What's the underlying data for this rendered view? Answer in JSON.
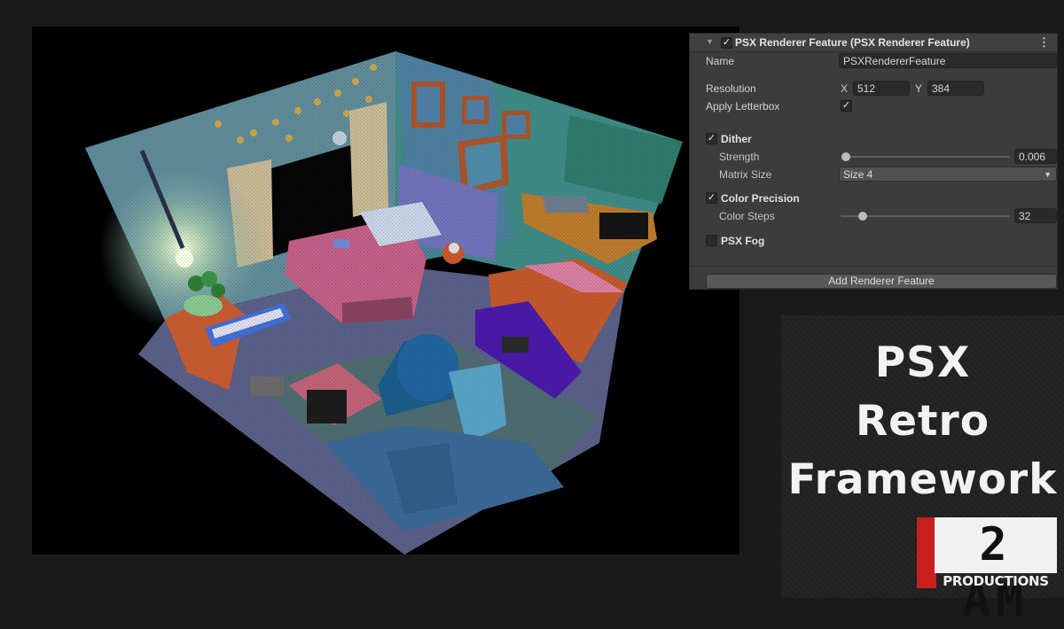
{
  "inspector": {
    "header_title": "PSX Renderer Feature (PSX Renderer Feature)",
    "menu_glyph": "⋮",
    "foldout_glyph": "▼",
    "check_glyph": "✓",
    "name_label": "Name",
    "name_value": "PSXRendererFeature",
    "resolution_label": "Resolution",
    "x_label": "X",
    "x_value": "512",
    "y_label": "Y",
    "y_value": "384",
    "letterbox_label": "Apply Letterbox",
    "letterbox_checked": true,
    "dither_label": "Dither",
    "dither_checked": true,
    "strength_label": "Strength",
    "strength_value": "0.006",
    "strength_fraction": 0.006,
    "matrix_label": "Matrix Size",
    "matrix_value": "Size 4",
    "color_precision_label": "Color Precision",
    "color_precision_checked": true,
    "color_steps_label": "Color Steps",
    "color_steps_value": "32",
    "psx_fog_label": "PSX Fog",
    "psx_fog_checked": false,
    "add_button_label": "Add Renderer Feature"
  },
  "brand": {
    "line1": "PSX",
    "line2": "Retro",
    "line3": "Framework",
    "logo_digits": "2 AM",
    "logo_sub": "PRODUCTIONS",
    "logo_red": "#c8201c"
  },
  "scene": {
    "description_icon": "isometric-bedroom-render"
  }
}
